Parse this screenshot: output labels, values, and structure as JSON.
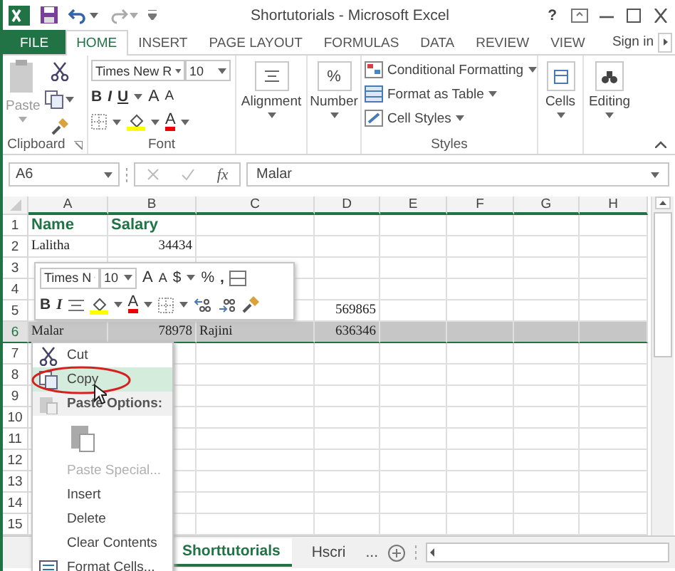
{
  "title_bar": {
    "title": "Shortutorials - Microsoft Excel",
    "help": "?"
  },
  "ribbon_tabs": [
    {
      "label": "FILE",
      "kind": "file",
      "selected": false
    },
    {
      "label": "HOME",
      "kind": "tab",
      "selected": true
    },
    {
      "label": "INSERT",
      "kind": "tab",
      "selected": false
    },
    {
      "label": "PAGE LAYOUT",
      "kind": "tab",
      "selected": false
    },
    {
      "label": "FORMULAS",
      "kind": "tab",
      "selected": false
    },
    {
      "label": "DATA",
      "kind": "tab",
      "selected": false
    },
    {
      "label": "REVIEW",
      "kind": "tab",
      "selected": false
    },
    {
      "label": "VIEW",
      "kind": "tab",
      "selected": false
    }
  ],
  "sign_in": "Sign in",
  "ribbon": {
    "clipboard": {
      "paste": "Paste",
      "label": "Clipboard"
    },
    "font": {
      "family": "Times New R",
      "size": "10",
      "bold": "B",
      "italic": "I",
      "underline": "U",
      "grow": "A",
      "shrink": "A",
      "font_color": "A",
      "label": "Font"
    },
    "alignment": "Alignment",
    "number": {
      "symbol": "%",
      "label": "Number"
    },
    "styles": {
      "items": [
        "Conditional Formatting",
        "Format as Table",
        "Cell Styles"
      ],
      "label": "Styles"
    },
    "cells": "Cells",
    "editing": "Editing"
  },
  "formula_bar": {
    "name_box": "A6",
    "function": "fx",
    "value": "Malar"
  },
  "columns": [
    "A",
    "B",
    "C",
    "D",
    "E",
    "F",
    "G",
    "H"
  ],
  "rows": [
    {
      "number": "1",
      "selected": false,
      "cells": {
        "A": {
          "text": "Name",
          "kind": "header"
        },
        "B": {
          "text": "Salary",
          "kind": "header"
        }
      }
    },
    {
      "number": "2",
      "selected": false,
      "cells": {
        "A": {
          "text": "Lalitha",
          "kind": "text"
        },
        "B": {
          "text": "34434",
          "kind": "number"
        }
      }
    },
    {
      "number": "3",
      "selected": false,
      "cells": {}
    },
    {
      "number": "4",
      "selected": false,
      "cells": {}
    },
    {
      "number": "5",
      "selected": false,
      "cells": {
        "D": {
          "text": "569865",
          "kind": "number"
        }
      }
    },
    {
      "number": "6",
      "selected": true,
      "cells": {
        "A": {
          "text": "Malar",
          "kind": "text"
        },
        "B": {
          "text": "78978",
          "kind": "number"
        },
        "C": {
          "text": "Rajini",
          "kind": "text"
        },
        "D": {
          "text": "636346",
          "kind": "number"
        }
      }
    },
    {
      "number": "7",
      "selected": false,
      "cells": {}
    },
    {
      "number": "8",
      "selected": false,
      "cells": {}
    },
    {
      "number": "9",
      "selected": false,
      "cells": {}
    },
    {
      "number": "10",
      "selected": false,
      "cells": {}
    },
    {
      "number": "11",
      "selected": false,
      "cells": {}
    },
    {
      "number": "12",
      "selected": false,
      "cells": {}
    },
    {
      "number": "13",
      "selected": false,
      "cells": {}
    },
    {
      "number": "14",
      "selected": false,
      "cells": {}
    },
    {
      "number": "15",
      "selected": false,
      "cells": {}
    }
  ],
  "mini_toolbar": {
    "font": "Times N",
    "size": "10",
    "grow": "A",
    "shrink": "A",
    "currency": "$",
    "percent": "%",
    "comma": ",",
    "bold": "B",
    "italic": "I",
    "font_color": "A"
  },
  "context_menu": [
    {
      "label": "Cut",
      "kind": "cut",
      "selected": false,
      "disabled": false
    },
    {
      "label": "Copy",
      "kind": "copy",
      "selected": true,
      "disabled": false
    },
    {
      "label": "Paste Options:",
      "kind": "header",
      "selected": false,
      "disabled": false
    },
    {
      "kind": "paste_buttons",
      "selected": false,
      "disabled": false
    },
    {
      "label": "Paste Special...",
      "kind": "plain",
      "selected": false,
      "disabled": true
    },
    {
      "label": "Insert",
      "kind": "plain",
      "selected": false,
      "disabled": false
    },
    {
      "label": "Delete",
      "kind": "plain",
      "selected": false,
      "disabled": false
    },
    {
      "label": "Clear Contents",
      "kind": "plain",
      "selected": false,
      "disabled": false
    },
    {
      "label": "Format Cells...",
      "kind": "format",
      "selected": false,
      "disabled": false
    }
  ],
  "sheet_tabs": [
    {
      "label": "Shorttutorials",
      "selected": true
    },
    {
      "label": "Hscri",
      "selected": false
    }
  ],
  "more_sheets": "..."
}
